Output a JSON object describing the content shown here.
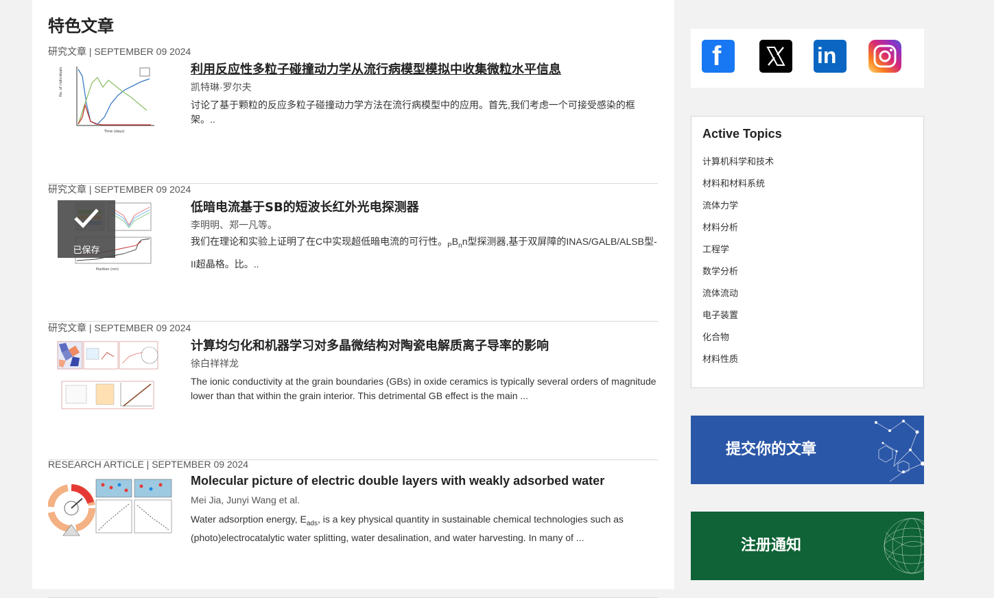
{
  "page_title": "特色文章",
  "articles": [
    {
      "meta": "研究文章 | SEPTEMBER 09 2024",
      "title": "利用反应性多粒子碰撞动力学从流行病模型模拟中收集微粒水平信息",
      "authors": "凯特琳·罗尔夫",
      "summary": "讨论了基于颗粒的反应多粒子碰撞动力学方法在流行病模型中的应用。首先,我们考虑一个可接受感染的框架。.."
    },
    {
      "meta": "研究文章 | SEPTEMBER 09 2024",
      "title": "低暗电流基于SB的短波长红外光电探测器",
      "authors": "李明明、郑一凡等。",
      "summary_pre": "我们在理论和实验上证明了在C中实现超低暗电流的可行性。",
      "summary_sub1": "P",
      "summary_mid": "B",
      "summary_sub2": "n",
      "summary_post": "n型探测器,基于双屏障的INAS/GALB/ALSB型-II超晶格。比。..",
      "saved_label": "已保存"
    },
    {
      "meta": "研究文章 | SEPTEMBER 09 2024",
      "title": "计算均匀化和机器学习对多晶微结构对陶瓷电解质离子导率的影响",
      "authors": "徐白祥祥龙",
      "summary": "The ionic conductivity at the grain boundaries (GBs) in oxide ceramics is typically several orders of magnitude lower than that within the grain interior. This detrimental GB effect is the main ..."
    },
    {
      "meta": "RESEARCH ARTICLE | SEPTEMBER 09 2024",
      "title": "Molecular picture of electric double layers with weakly adsorbed water",
      "authors": "Mei Jia, Junyi Wang et al.",
      "summary_pre": "Water adsorption energy, E",
      "summary_sub": "ads",
      "summary_post": ", is a key physical quantity in sustainable chemical technologies such as (photo)electrocatalytic water splitting, water desalination, and water harvesting. In many of ..."
    }
  ],
  "social": {
    "icons": [
      "facebook-icon",
      "x-icon",
      "linkedin-icon",
      "instagram-icon"
    ],
    "facebook_glyph": "f",
    "x_glyph": "𝕏",
    "linkedin_glyph": "in"
  },
  "topics": {
    "heading": "Active Topics",
    "items": [
      "计算机科学和技术",
      "材料和材料系统",
      "流体力学",
      "材料分析",
      "工程学",
      "数学分析",
      "流体流动",
      "电子装置",
      "化合物",
      "材料性质"
    ]
  },
  "banners": {
    "submit": "提交你的文章",
    "register": "注册通知"
  },
  "colors": {
    "submit_banner": "#2b57a8",
    "register_banner": "#0f6336",
    "facebook": "#1877f2",
    "linkedin": "#0a66c2"
  }
}
